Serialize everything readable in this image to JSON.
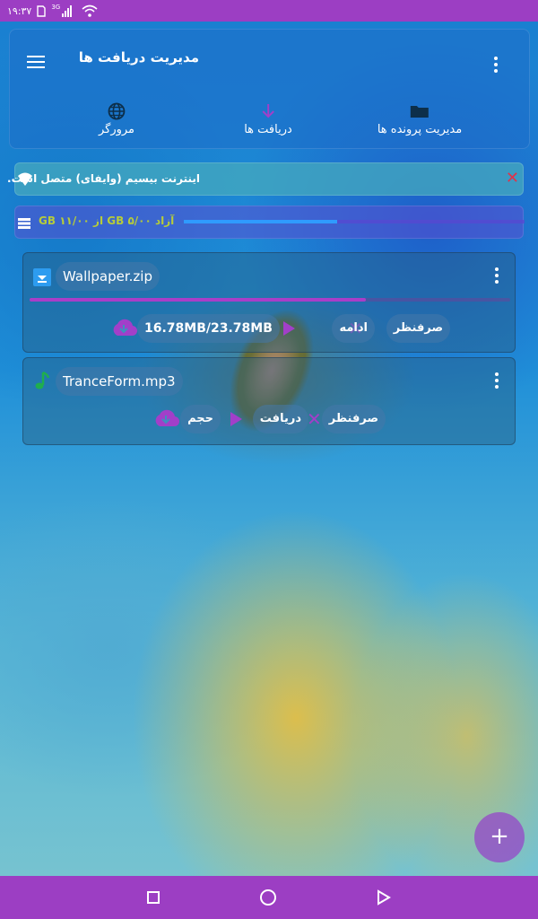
{
  "status_bar": {
    "time": "۱۹:۳۷",
    "network": "3G"
  },
  "header": {
    "title": "مدیریت دریافت ها",
    "tabs": [
      {
        "label": "مرورگر",
        "icon": "globe-icon"
      },
      {
        "label": "دریافت ها",
        "icon": "download-arrow-icon"
      },
      {
        "label": "مدیریت پرونده ها",
        "icon": "folder-icon"
      }
    ]
  },
  "wifi_banner": {
    "text": "اینترنت بیسیم (وایفای) متصل است."
  },
  "storage": {
    "text": "آزاد ۵/۰۰ GB از ۱۱/۰۰ GB",
    "used_fraction": 0.45
  },
  "downloads": [
    {
      "file_name": "Wallpaper.zip",
      "progress": 0.7,
      "size_text": "16.78MB/23.78MB",
      "action_label": "ادامه",
      "cancel_label": "صرفنظر"
    },
    {
      "file_name": "TranceForm.mp3",
      "size_text": "حجم",
      "action_label": "دریافت",
      "cancel_label": "صرفنظر"
    }
  ],
  "fab": {
    "label": "+"
  },
  "colors": {
    "accent": "#9c3ec3",
    "close_red": "#e0334a",
    "storage_text": "#b6cc3a",
    "storage_bar": "#2f9bff"
  }
}
